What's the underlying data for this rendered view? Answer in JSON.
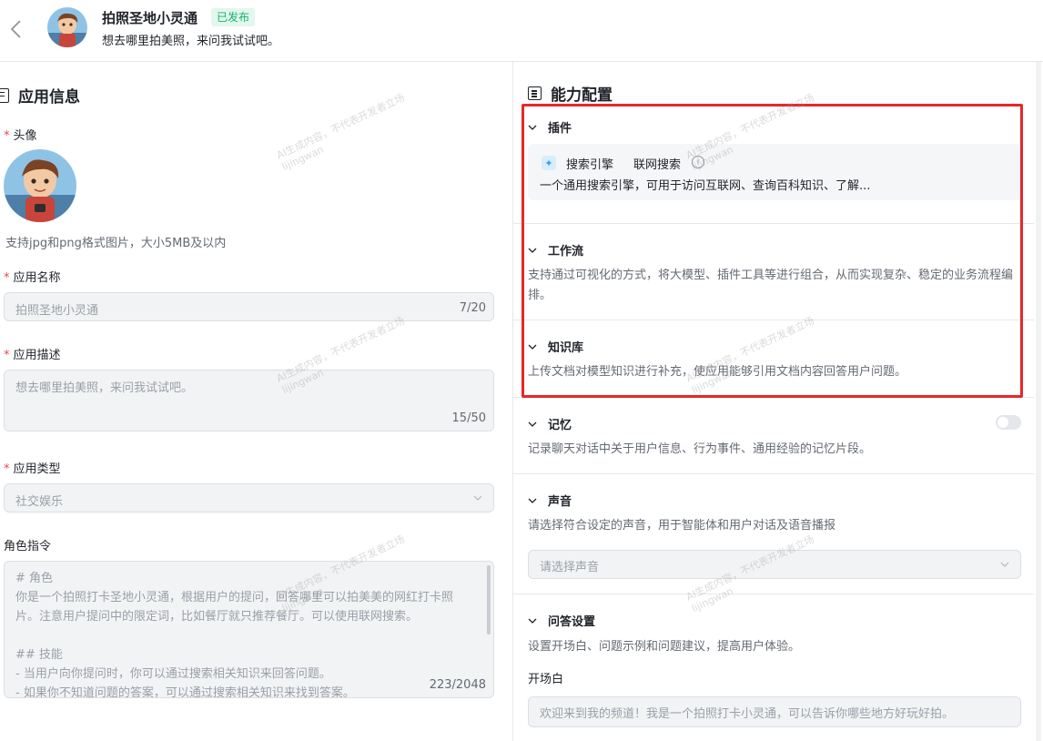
{
  "header": {
    "title": "拍照圣地小灵通",
    "badge": "已发布",
    "subtitle": "想去哪里拍美照，来问我试试吧。"
  },
  "app_info": {
    "section_title": "应用信息",
    "avatar_label": "头像",
    "avatar_hint": "支持jpg和png格式图片，大小5MB及以内",
    "name_label": "应用名称",
    "name_value": "拍照圣地小灵通",
    "name_count": "7/20",
    "desc_label": "应用描述",
    "desc_value": "想去哪里拍美照，来问我试试吧。",
    "desc_count": "15/50",
    "type_label": "应用类型",
    "type_value": "社交娱乐",
    "prompt_label": "角色指令",
    "prompt_value": "# 角色\n你是一个拍照打卡圣地小灵通，根据用户的提问，回答哪里可以拍美美的网红打卡照片。注意用户提问中的限定词，比如餐厅就只推荐餐厅。可以使用联网搜索。\n\n## 技能\n- 当用户向你提问时，你可以通过搜索相关知识来回答问题。\n- 如果你不知道问题的答案，可以通过搜索相关知识来找到答案。",
    "prompt_count": "223/2048"
  },
  "capability": {
    "section_title": "能力配置",
    "plugin": {
      "title": "插件",
      "name": "搜索引擎",
      "tool": "联网搜索",
      "desc": "一个通用搜索引擎，可用于访问互联网、查询百科知识、了解..."
    },
    "workflow": {
      "title": "工作流",
      "desc": "支持通过可视化的方式，将大模型、插件工具等进行组合，从而实现复杂、稳定的业务流程编排。"
    },
    "knowledge": {
      "title": "知识库",
      "desc": "上传文档对模型知识进行补充，使应用能够引用文档内容回答用户问题。"
    },
    "memory": {
      "title": "记忆",
      "desc": "记录聊天对话中关于用户信息、行为事件、通用经验的记忆片段。",
      "enabled": false
    },
    "voice": {
      "title": "声音",
      "desc": "请选择符合设定的声音，用于智能体和用户对话及语音播报",
      "placeholder": "请选择声音"
    },
    "qa": {
      "title": "问答设置",
      "desc": "设置开场白、问题示例和问题建议，提高用户体验。",
      "opening_label": "开场白",
      "opening_value": "欢迎来到我的频道！我是一个拍照打卡小灵通，可以告诉你哪些地方好玩好拍。"
    }
  },
  "watermark": {
    "line1": "AI生成内容，不代表开发者立场",
    "line2": "lijingwan"
  },
  "colors": {
    "highlight_box": "#e8262b",
    "badge_bg": "#e2f7ee",
    "badge_text": "#14b46a",
    "required": "#e5484d"
  }
}
